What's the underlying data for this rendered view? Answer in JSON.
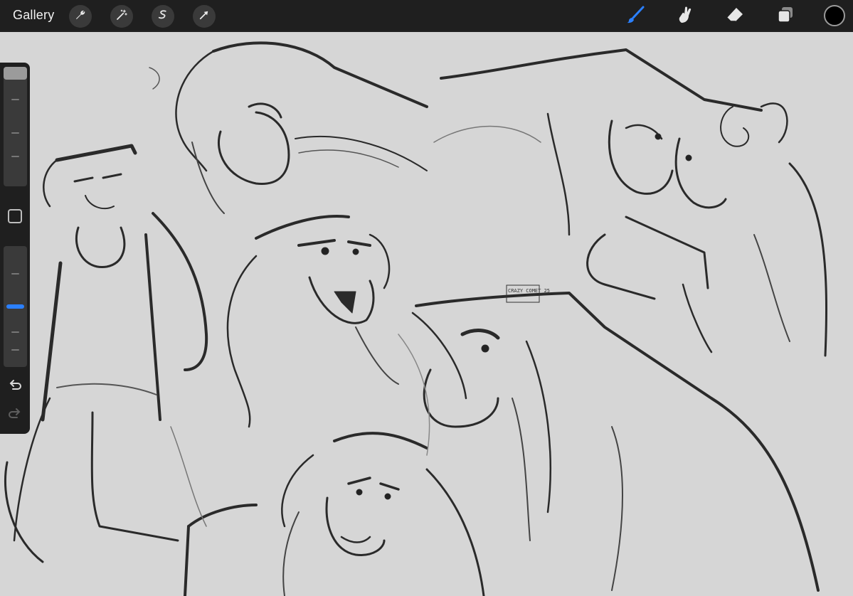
{
  "toolbar": {
    "gallery_label": "Gallery",
    "left_tools": [
      "wrench-icon",
      "magic-wand-icon",
      "selection-icon",
      "transform-arrow-icon"
    ],
    "right_tools": [
      "brush-icon",
      "smudge-icon",
      "eraser-icon",
      "layers-icon"
    ],
    "active_tool": "brush-icon",
    "active_color": "#000000",
    "accent_color": "#2b80ff"
  },
  "sidebar": {
    "brush_size_level": 0.0,
    "opacity_level": 0.28,
    "icons": [
      "modify-square-icon",
      "undo-icon",
      "redo-icon"
    ]
  },
  "canvas": {
    "background": "#d6d6d6",
    "signature_text": "CRAZY COMET 25"
  }
}
